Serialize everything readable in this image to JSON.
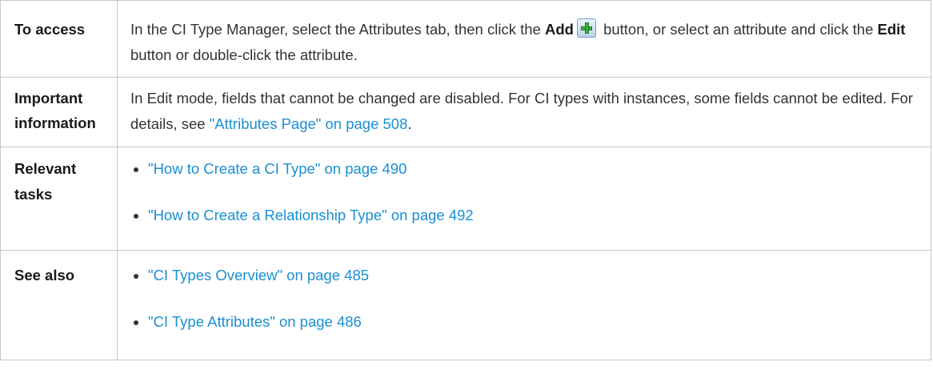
{
  "rows": {
    "access": {
      "label": "To access",
      "t1": "In the CI Type Manager, select the Attributes tab, then click the ",
      "add_bold": "Add",
      "add_icon": "add-plus-icon",
      "t2": " button, or select an attribute and click the ",
      "edit_bold": "Edit",
      "t3": " button or double-click the attribute."
    },
    "important": {
      "label_line1": "Important",
      "label_line2": "information",
      "t1": "In Edit mode, fields that cannot be changed are disabled. For CI types with instances, some fields cannot be edited. For details, see ",
      "link": "\"Attributes Page\" on page 508",
      "t2": "."
    },
    "tasks": {
      "label_line1": "Relevant",
      "label_line2": "tasks",
      "items": [
        "\"How to Create a CI Type\" on page 490",
        "\"How to Create a Relationship Type\" on page 492"
      ]
    },
    "see_also": {
      "label": "See also",
      "items": [
        "\"CI Types Overview\" on page 485",
        "\"CI Type Attributes\" on page 486"
      ]
    }
  },
  "colors": {
    "link": "#1a8fd2",
    "border": "#c8c8c8",
    "text": "#333333"
  }
}
